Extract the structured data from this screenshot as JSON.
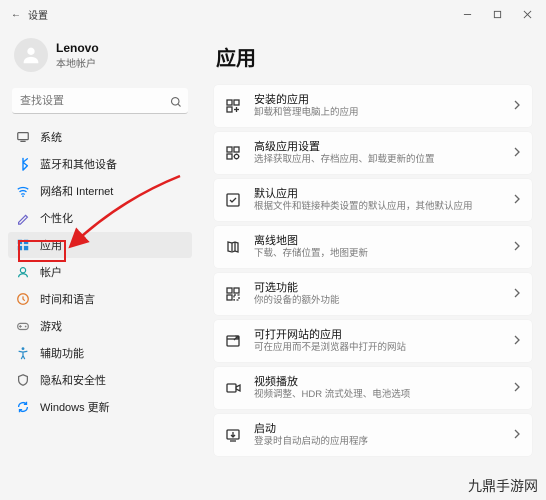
{
  "window": {
    "title": "设置",
    "back_icon": "←"
  },
  "profile": {
    "name": "Lenovo",
    "sub": "本地帐户"
  },
  "search": {
    "placeholder": "查找设置"
  },
  "sidebar_icons": {
    "system": "#616161",
    "bluetooth": "#0a84ff",
    "network": "#0a84ff",
    "personalization": "#6b63c9",
    "apps": "#2188d9",
    "accounts": "#1aa0a0",
    "time": "#e07b2e",
    "gaming": "#808080",
    "accessibility": "#2b8cc9",
    "privacy": "#6a6a6a",
    "update": "#0a84ff"
  },
  "sidebar": [
    {
      "key": "system",
      "label": "系统"
    },
    {
      "key": "bluetooth",
      "label": "蓝牙和其他设备"
    },
    {
      "key": "network",
      "label": "网络和 Internet"
    },
    {
      "key": "personalization",
      "label": "个性化"
    },
    {
      "key": "apps",
      "label": "应用",
      "active": true
    },
    {
      "key": "accounts",
      "label": "帐户"
    },
    {
      "key": "time",
      "label": "时间和语言"
    },
    {
      "key": "gaming",
      "label": "游戏"
    },
    {
      "key": "accessibility",
      "label": "辅助功能"
    },
    {
      "key": "privacy",
      "label": "隐私和安全性"
    },
    {
      "key": "update",
      "label": "Windows 更新"
    }
  ],
  "main": {
    "heading": "应用"
  },
  "cards": [
    {
      "key": "installed",
      "title": "安装的应用",
      "desc": "卸载和管理电脑上的应用"
    },
    {
      "key": "advanced",
      "title": "高级应用设置",
      "desc": "选择获取应用、存档应用、卸载更新的位置"
    },
    {
      "key": "defaults",
      "title": "默认应用",
      "desc": "根据文件和链接种类设置的默认应用，其他默认应用"
    },
    {
      "key": "offline",
      "title": "离线地图",
      "desc": "下载、存储位置，地图更新"
    },
    {
      "key": "optional",
      "title": "可选功能",
      "desc": "你的设备的额外功能"
    },
    {
      "key": "openweb",
      "title": "可打开网站的应用",
      "desc": "可在应用而不是浏览器中打开的网站"
    },
    {
      "key": "video",
      "title": "视频播放",
      "desc": "视频调整、HDR 流式处理、电池选项"
    },
    {
      "key": "startup",
      "title": "启动",
      "desc": "登录时自动启动的应用程序"
    }
  ],
  "watermark": "九鼎手游网"
}
